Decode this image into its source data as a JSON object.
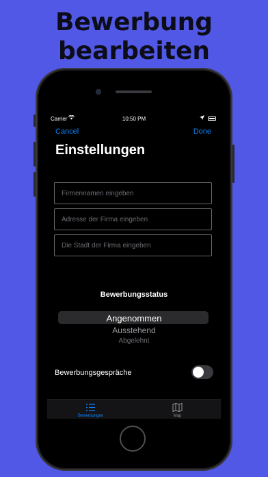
{
  "headline": {
    "line1": "Bewerbung",
    "line2": "bearbeiten"
  },
  "status_bar": {
    "carrier": "Carrier",
    "time": "10:50 PM"
  },
  "nav": {
    "cancel_label": "Cancel",
    "done_label": "Done",
    "title": "Einstellungen"
  },
  "form": {
    "company_name_placeholder": "Firmennamen eingeben",
    "company_address_placeholder": "Adresse der Firma eingeben",
    "company_city_placeholder": "Die Stadt der Firma eingeben"
  },
  "status_picker": {
    "label": "Bewerbungsstatus",
    "options": [
      "Angenommen",
      "Ausstehend",
      "Abgelehnt"
    ],
    "selected": "Angenommen"
  },
  "interviews_toggle": {
    "label": "Bewerbungsgespräche",
    "on": false
  },
  "tabbar": {
    "tabs": [
      {
        "label": "Bewerbungen",
        "icon": "list-icon",
        "active": true
      },
      {
        "label": "Map",
        "icon": "map-icon",
        "active": false
      }
    ]
  },
  "colors": {
    "background": "#5158e6",
    "accent": "#0a84ff"
  }
}
